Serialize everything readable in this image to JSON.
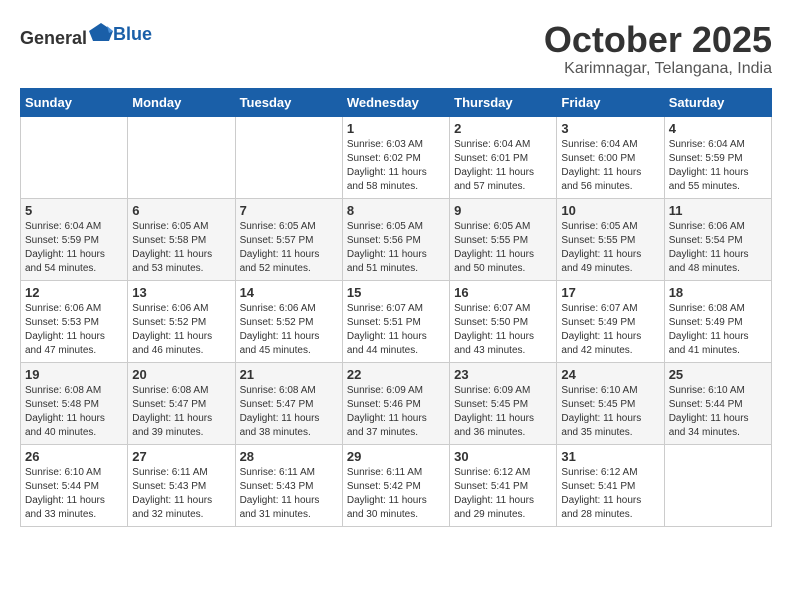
{
  "header": {
    "logo_general": "General",
    "logo_blue": "Blue",
    "month": "October 2025",
    "location": "Karimnagar, Telangana, India"
  },
  "weekdays": [
    "Sunday",
    "Monday",
    "Tuesday",
    "Wednesday",
    "Thursday",
    "Friday",
    "Saturday"
  ],
  "weeks": [
    [
      {
        "day": "",
        "info": ""
      },
      {
        "day": "",
        "info": ""
      },
      {
        "day": "",
        "info": ""
      },
      {
        "day": "1",
        "info": "Sunrise: 6:03 AM\nSunset: 6:02 PM\nDaylight: 11 hours\nand 58 minutes."
      },
      {
        "day": "2",
        "info": "Sunrise: 6:04 AM\nSunset: 6:01 PM\nDaylight: 11 hours\nand 57 minutes."
      },
      {
        "day": "3",
        "info": "Sunrise: 6:04 AM\nSunset: 6:00 PM\nDaylight: 11 hours\nand 56 minutes."
      },
      {
        "day": "4",
        "info": "Sunrise: 6:04 AM\nSunset: 5:59 PM\nDaylight: 11 hours\nand 55 minutes."
      }
    ],
    [
      {
        "day": "5",
        "info": "Sunrise: 6:04 AM\nSunset: 5:59 PM\nDaylight: 11 hours\nand 54 minutes."
      },
      {
        "day": "6",
        "info": "Sunrise: 6:05 AM\nSunset: 5:58 PM\nDaylight: 11 hours\nand 53 minutes."
      },
      {
        "day": "7",
        "info": "Sunrise: 6:05 AM\nSunset: 5:57 PM\nDaylight: 11 hours\nand 52 minutes."
      },
      {
        "day": "8",
        "info": "Sunrise: 6:05 AM\nSunset: 5:56 PM\nDaylight: 11 hours\nand 51 minutes."
      },
      {
        "day": "9",
        "info": "Sunrise: 6:05 AM\nSunset: 5:55 PM\nDaylight: 11 hours\nand 50 minutes."
      },
      {
        "day": "10",
        "info": "Sunrise: 6:05 AM\nSunset: 5:55 PM\nDaylight: 11 hours\nand 49 minutes."
      },
      {
        "day": "11",
        "info": "Sunrise: 6:06 AM\nSunset: 5:54 PM\nDaylight: 11 hours\nand 48 minutes."
      }
    ],
    [
      {
        "day": "12",
        "info": "Sunrise: 6:06 AM\nSunset: 5:53 PM\nDaylight: 11 hours\nand 47 minutes."
      },
      {
        "day": "13",
        "info": "Sunrise: 6:06 AM\nSunset: 5:52 PM\nDaylight: 11 hours\nand 46 minutes."
      },
      {
        "day": "14",
        "info": "Sunrise: 6:06 AM\nSunset: 5:52 PM\nDaylight: 11 hours\nand 45 minutes."
      },
      {
        "day": "15",
        "info": "Sunrise: 6:07 AM\nSunset: 5:51 PM\nDaylight: 11 hours\nand 44 minutes."
      },
      {
        "day": "16",
        "info": "Sunrise: 6:07 AM\nSunset: 5:50 PM\nDaylight: 11 hours\nand 43 minutes."
      },
      {
        "day": "17",
        "info": "Sunrise: 6:07 AM\nSunset: 5:49 PM\nDaylight: 11 hours\nand 42 minutes."
      },
      {
        "day": "18",
        "info": "Sunrise: 6:08 AM\nSunset: 5:49 PM\nDaylight: 11 hours\nand 41 minutes."
      }
    ],
    [
      {
        "day": "19",
        "info": "Sunrise: 6:08 AM\nSunset: 5:48 PM\nDaylight: 11 hours\nand 40 minutes."
      },
      {
        "day": "20",
        "info": "Sunrise: 6:08 AM\nSunset: 5:47 PM\nDaylight: 11 hours\nand 39 minutes."
      },
      {
        "day": "21",
        "info": "Sunrise: 6:08 AM\nSunset: 5:47 PM\nDaylight: 11 hours\nand 38 minutes."
      },
      {
        "day": "22",
        "info": "Sunrise: 6:09 AM\nSunset: 5:46 PM\nDaylight: 11 hours\nand 37 minutes."
      },
      {
        "day": "23",
        "info": "Sunrise: 6:09 AM\nSunset: 5:45 PM\nDaylight: 11 hours\nand 36 minutes."
      },
      {
        "day": "24",
        "info": "Sunrise: 6:10 AM\nSunset: 5:45 PM\nDaylight: 11 hours\nand 35 minutes."
      },
      {
        "day": "25",
        "info": "Sunrise: 6:10 AM\nSunset: 5:44 PM\nDaylight: 11 hours\nand 34 minutes."
      }
    ],
    [
      {
        "day": "26",
        "info": "Sunrise: 6:10 AM\nSunset: 5:44 PM\nDaylight: 11 hours\nand 33 minutes."
      },
      {
        "day": "27",
        "info": "Sunrise: 6:11 AM\nSunset: 5:43 PM\nDaylight: 11 hours\nand 32 minutes."
      },
      {
        "day": "28",
        "info": "Sunrise: 6:11 AM\nSunset: 5:43 PM\nDaylight: 11 hours\nand 31 minutes."
      },
      {
        "day": "29",
        "info": "Sunrise: 6:11 AM\nSunset: 5:42 PM\nDaylight: 11 hours\nand 30 minutes."
      },
      {
        "day": "30",
        "info": "Sunrise: 6:12 AM\nSunset: 5:41 PM\nDaylight: 11 hours\nand 29 minutes."
      },
      {
        "day": "31",
        "info": "Sunrise: 6:12 AM\nSunset: 5:41 PM\nDaylight: 11 hours\nand 28 minutes."
      },
      {
        "day": "",
        "info": ""
      }
    ]
  ]
}
